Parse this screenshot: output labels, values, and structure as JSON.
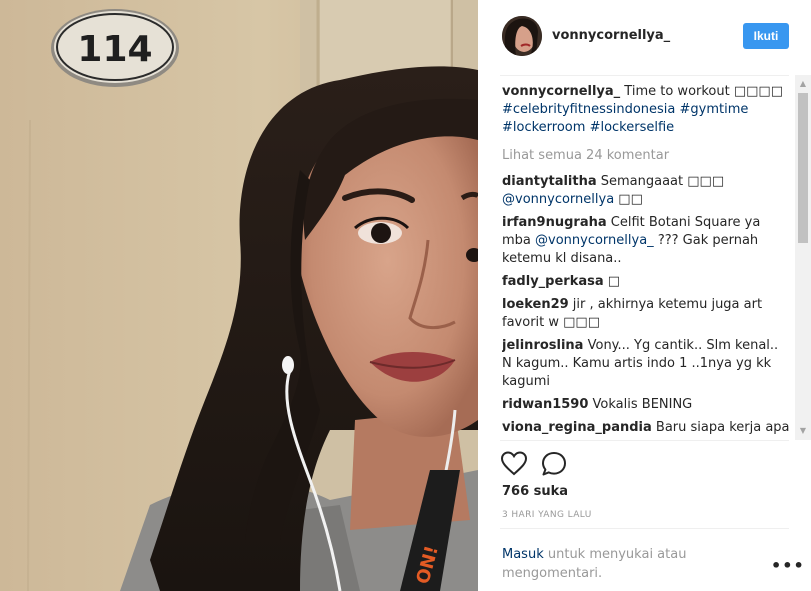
{
  "post": {
    "username": "vonnycornellya_",
    "follow_label": "Ikuti",
    "room_number": "114",
    "badge_text": "ON!"
  },
  "caption": {
    "username": "vonnycornellya_",
    "text": " Time to workout ",
    "emoji": "□□□□",
    "hashtags": [
      "#celebrityfitnessindonesia",
      "#gymtime",
      "#lockerroom",
      "#lockerselfie"
    ]
  },
  "view_all_label": "Lihat semua 24 komentar",
  "comments": [
    {
      "user": "diantytalitha",
      "pre": " Semangaaat □□□ ",
      "mention": "@vonnycornellya",
      "post": " □□"
    },
    {
      "user": "irfan9nugraha",
      "pre": " Celfit Botani Square ya mba ",
      "mention": "@vonnycornellya_",
      "post": " ??? Gak pernah ketemu kl disana.."
    },
    {
      "user": "fadly_perkasa",
      "pre": " □",
      "mention": "",
      "post": ""
    },
    {
      "user": "loeken29",
      "pre": " jir , akhirnya ketemu juga art favorit w □□□",
      "mention": "",
      "post": ""
    },
    {
      "user": "jelinroslina",
      "pre": " Vony... Yg cantik.. Slm kenal.. N kagum.. Kamu artis indo 1 ..1nya yg kk kagumi",
      "mention": "",
      "post": ""
    },
    {
      "user": "ridwan1590",
      "pre": " Vokalis BENING",
      "mention": "",
      "post": ""
    },
    {
      "user": "viona_regina_pandia",
      "pre": " Baru siapa kerja apa",
      "mention": "",
      "post": ""
    }
  ],
  "likes_label": "766 suka",
  "time_label": "3 HARI YANG LALU",
  "login": {
    "link": "Masuk",
    "text": " untuk menyukai atau mengomentari."
  },
  "icons": {
    "like": "heart-icon",
    "comment": "comment-bubble-icon",
    "more": "more-options-icon"
  },
  "colors": {
    "accent": "#3897f0",
    "link": "#003569",
    "muted": "#999999"
  }
}
